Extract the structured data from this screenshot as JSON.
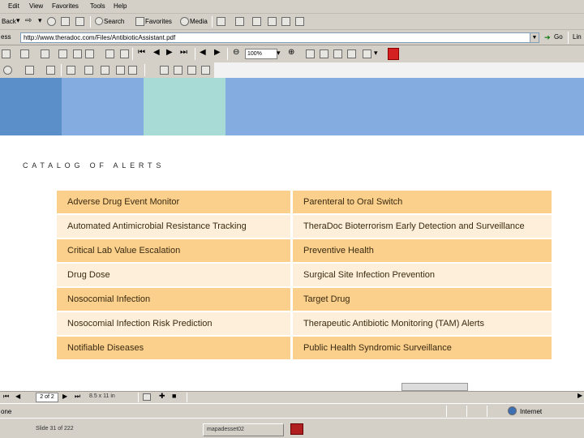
{
  "menu": {
    "items": [
      "Edit",
      "View",
      "Favorites",
      "Tools",
      "Help"
    ]
  },
  "toolbar": {
    "back_label": "Back",
    "search_label": "Search",
    "favorites_label": "Favorites",
    "media_label": "Media"
  },
  "address": {
    "label": "ess",
    "url": "http://www.theradoc.com/Files/AntibioticAssistant.pdf",
    "go_label": "Go",
    "links_label": "Lin"
  },
  "pdf_toolbar": {
    "zoom": "100%"
  },
  "document": {
    "heading": "CATALOG OF ALERTS",
    "alerts_left": [
      "Adverse Drug Event Monitor",
      "Automated Antimicrobial Resistance Tracking",
      "Critical Lab Value Escalation",
      "Drug Dose",
      "Nosocomial Infection",
      "Nosocomial Infection Risk Prediction",
      "Notifiable Diseases"
    ],
    "alerts_right": [
      "Parenteral to Oral Switch",
      "TheraDoc Bioterrorism Early Detection and Surveillance",
      "Preventive Health",
      "Surgical Site Infection Prevention",
      "Target Drug",
      "Therapeutic Antibiotic Monitoring (TAM) Alerts",
      "Public Health Syndromic Surveillance"
    ]
  },
  "pdf_nav": {
    "page_info": "2 of 2",
    "page_size": "8.5 x 11 in"
  },
  "status": {
    "left_text": "one",
    "zone": "Internet"
  },
  "taskbar": {
    "slide_info": "Slide 31 of 222",
    "app_name": "mapadesset02"
  },
  "colors": {
    "banner": [
      "#5a8fc9",
      "#85ace0",
      "#a8dbd6",
      "#84ace0"
    ],
    "row_dark": "#fbd08d",
    "row_light": "#fdefd9"
  }
}
